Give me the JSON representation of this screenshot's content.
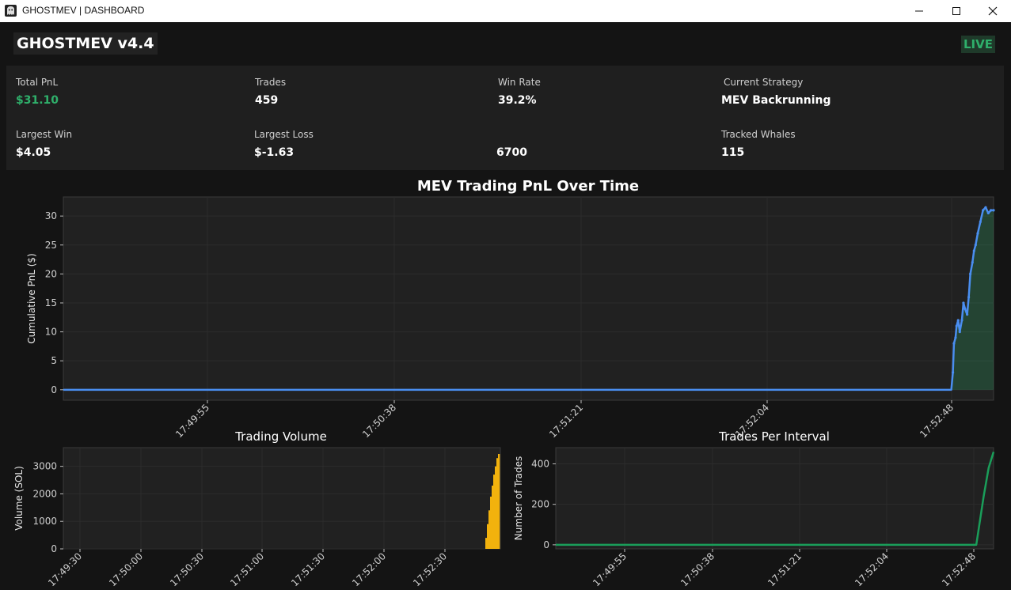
{
  "window": {
    "title": "GHOSTMEV | DASHBOARD"
  },
  "header": {
    "app_name": "GHOSTMEV v4.4",
    "status": "LIVE",
    "status_color": "#2fb06b"
  },
  "stats": {
    "total_pnl_label": "Total PnL",
    "total_pnl": "$31.10",
    "trades_label": "Trades",
    "trades": "459",
    "win_rate_label": "Win Rate",
    "win_rate": "39.2%",
    "strategy_label": "Current Strategy",
    "strategy": "MEV Backrunning",
    "largest_win_label": "Largest Win",
    "largest_win": "$4.05",
    "largest_loss_label": "Largest Loss",
    "largest_loss": "$-1.63",
    "unlabeled_value": "6700",
    "whales_label": "Tracked Whales",
    "whales": "115"
  },
  "chart_data": [
    {
      "id": "pnl",
      "type": "area",
      "title": "MEV Trading PnL Over Time",
      "xlabel": "",
      "ylabel": "Cumulative PnL ($)",
      "x_ticks": [
        "17:49:55",
        "17:50:38",
        "17:51:21",
        "17:52:04",
        "17:52:48"
      ],
      "y_ticks": [
        0,
        5,
        10,
        15,
        20,
        25,
        30
      ],
      "ylim": [
        -1.8,
        33.3
      ],
      "color": "#4a8ef0",
      "x_seconds": [
        0,
        10,
        20,
        30,
        40,
        50,
        60,
        70,
        80,
        90,
        100,
        110,
        120,
        130,
        140,
        150,
        160,
        168,
        168.3,
        168.5,
        168.8,
        169.0,
        169.3,
        169.6,
        170,
        170.3,
        170.6,
        171,
        171.3,
        171.6,
        172,
        172.3,
        172.6,
        173,
        173.5,
        174,
        174.5,
        175,
        175.5,
        176
      ],
      "values": [
        0,
        0,
        0,
        0,
        0,
        0,
        0,
        0,
        0,
        0,
        0,
        0,
        0,
        0,
        0,
        0,
        0,
        0,
        3,
        8,
        9,
        11,
        12,
        10,
        12,
        15,
        14,
        13,
        16,
        20,
        22,
        24,
        25,
        27,
        29,
        31,
        31.5,
        30.5,
        31,
        31
      ]
    },
    {
      "id": "volume",
      "type": "bar",
      "title": "Trading Volume",
      "xlabel": "",
      "ylabel": "Volume (SOL)",
      "x_ticks": [
        "17:49:30",
        "17:50:00",
        "17:50:30",
        "17:51:00",
        "17:51:30",
        "17:52:00",
        "17:52:30"
      ],
      "y_ticks": [
        0,
        1000,
        2000,
        3000
      ],
      "ylim": [
        0,
        3680
      ],
      "color": "#f2b20d",
      "bars_from": "17:52:48",
      "values": [
        0,
        400,
        900,
        1400,
        1900,
        2300,
        2700,
        3000,
        3300,
        3450
      ]
    },
    {
      "id": "trades",
      "type": "line",
      "title": "Trades Per Interval",
      "xlabel": "",
      "ylabel": "Number of Trades",
      "x_ticks": [
        "17:49:55",
        "17:50:38",
        "17:51:21",
        "17:52:04",
        "17:52:48"
      ],
      "y_ticks": [
        0,
        200,
        400
      ],
      "ylim": [
        -20,
        480
      ],
      "color": "#1a9e5a",
      "x_seconds": [
        0,
        40,
        80,
        120,
        160,
        170,
        171,
        173,
        175,
        177
      ],
      "values": [
        0,
        0,
        0,
        0,
        0,
        0,
        80,
        240,
        380,
        459
      ]
    }
  ]
}
